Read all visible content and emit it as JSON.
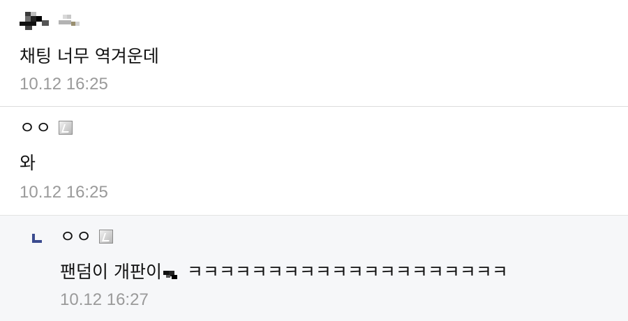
{
  "comments": [
    {
      "author": "",
      "text": "채팅 너무 역겨운데",
      "time": "10.12 16:25"
    },
    {
      "author": "ㅇㅇ",
      "text": "와",
      "time": "10.12 16:25"
    },
    {
      "author": "ㅇㅇ",
      "text_before": "팬덤이 개판이",
      "text_after": "ㅋㅋㅋㅋㅋㅋㅋㅋㅋㅋㅋㅋㅋㅋㅋㅋㅋㅋㅋㅋ",
      "time": "10.12 16:27",
      "is_reply": true
    }
  ],
  "icons": {
    "badge": "fixed-nick-badge-icon",
    "reply": "reply-arrow-icon",
    "emoji": "censored-emoji-icon"
  },
  "colors": {
    "reply_bg": "#f6f7f9",
    "time": "#9a9a9a",
    "divider": "#dcdcdc",
    "reply_mark": "#3b4b8f"
  }
}
